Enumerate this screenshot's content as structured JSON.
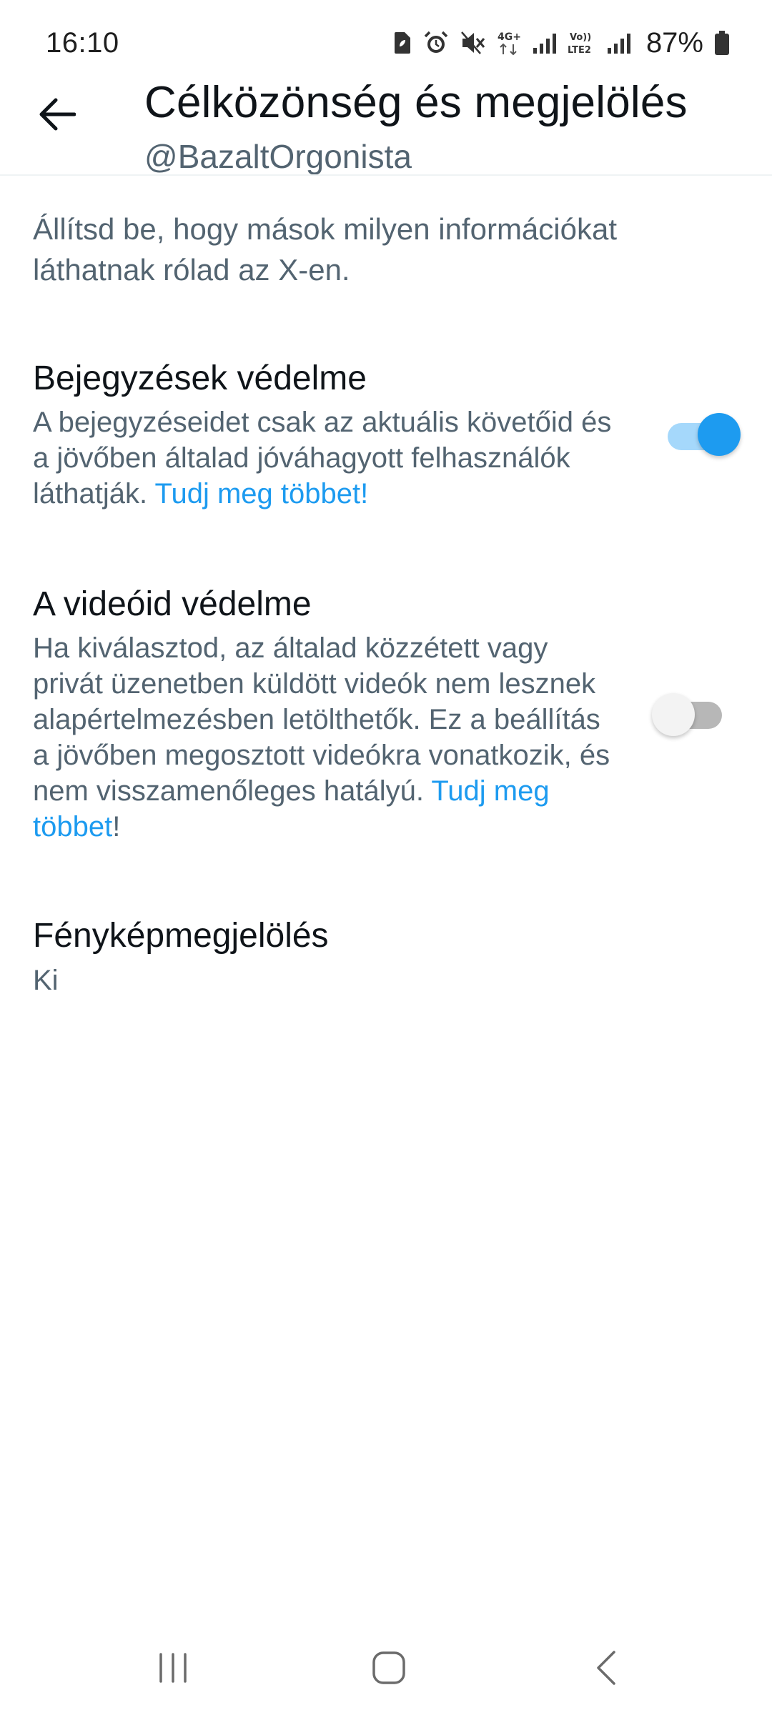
{
  "status_bar": {
    "time": "16:10",
    "battery": "87%",
    "network_4g": "4G+",
    "volte": "Vo)) LTE2",
    "icons": [
      "sim-icon",
      "alarm-icon",
      "mute-icon",
      "network-4g-icon",
      "signal-icon",
      "volte-icon",
      "signal-icon",
      "battery-icon"
    ]
  },
  "header": {
    "title": "Célközönség és megjelölés",
    "subtitle": "@BazaltOrgonista",
    "back_icon": "arrow-left-icon"
  },
  "intro": "Állítsd be, hogy mások milyen információkat láthatnak rólad az X-en.",
  "settings": {
    "protect_posts": {
      "title": "Bejegyzések védelme",
      "desc": "A bejegyzéseidet csak az aktuális követőid és a jövőben általad jóváhagyott felhasználók láthatják.",
      "link": "Tudj meg többet!",
      "enabled": true
    },
    "protect_videos": {
      "title": "A videóid védelme",
      "desc": "Ha kiválasztod, az általad közzétett vagy privát üzenetben küldött videók nem lesznek alapértelmezésben letölthetők. Ez a beállítás a jövőben megosztott videókra vonatkozik, és nem visszamenőleges hatályú.",
      "link": "Tudj meg többet",
      "suffix": "!",
      "enabled": false
    },
    "photo_tagging": {
      "title": "Fényképmegjelölés",
      "value": "Ki"
    }
  },
  "nav_bar": {
    "icons": [
      "recents-icon",
      "home-icon",
      "back-icon"
    ]
  },
  "colors": {
    "accent": "#1d9bf0",
    "accent_track": "#a5d8fb",
    "secondary_text": "#536471",
    "primary_text": "#0f1419"
  }
}
